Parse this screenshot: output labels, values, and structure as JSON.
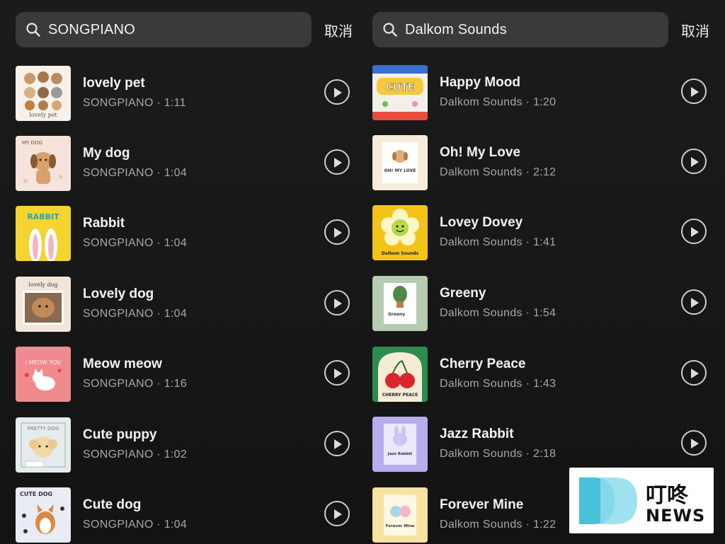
{
  "left": {
    "search": {
      "query": "SONGPIANO"
    },
    "cancel_label": "取消",
    "songs": [
      {
        "title": "lovely pet",
        "meta": "SONGPIANO · 1:11",
        "cover_text": "lovely pet"
      },
      {
        "title": "My dog",
        "meta": "SONGPIANO · 1:04",
        "cover_text": "MY DOG"
      },
      {
        "title": "Rabbit",
        "meta": "SONGPIANO · 1:04",
        "cover_text": "RABBIT"
      },
      {
        "title": "Lovely dog",
        "meta": "SONGPIANO · 1:04",
        "cover_text": "lovely dog"
      },
      {
        "title": "Meow meow",
        "meta": "SONGPIANO · 1:16",
        "cover_text": "I MEOW YOU"
      },
      {
        "title": "Cute puppy",
        "meta": "SONGPIANO · 1:02",
        "cover_text": "PRETTY DOG"
      },
      {
        "title": "Cute dog",
        "meta": "SONGPIANO · 1:04",
        "cover_text": "CUTE DOG"
      }
    ]
  },
  "right": {
    "search": {
      "query": "Dalkom Sounds"
    },
    "cancel_label": "取消",
    "songs": [
      {
        "title": "Happy Mood",
        "meta": "Dalkom Sounds · 1:20",
        "cover_text": "CUTE"
      },
      {
        "title": "Oh! My Love",
        "meta": "Dalkom Sounds · 2:12",
        "cover_text": "OH! MY LOVE"
      },
      {
        "title": "Lovey Dovey",
        "meta": "Dalkom Sounds · 1:41",
        "cover_text": "Dalkom Sounds"
      },
      {
        "title": "Greeny",
        "meta": "Dalkom Sounds · 1:54",
        "cover_text": "Greeny"
      },
      {
        "title": "Cherry Peace",
        "meta": "Dalkom Sounds · 1:43",
        "cover_text": "CHERRY PEACE"
      },
      {
        "title": "Jazz Rabbit",
        "meta": "Dalkom Sounds · 2:18",
        "cover_text": "Jazz Rabbit"
      },
      {
        "title": "Forever Mine",
        "meta": "Dalkom Sounds · 1:22",
        "cover_text": "Forever Mine"
      }
    ]
  },
  "watermark": {
    "cn": "叮咚",
    "en": "NEWS"
  },
  "icons": {
    "search": "search-icon",
    "play": "play-circle-icon"
  },
  "colors": {
    "background": "#161616",
    "search_box": "#3a3a3a",
    "title": "#f3f3f3",
    "meta": "#a7a7a7"
  }
}
